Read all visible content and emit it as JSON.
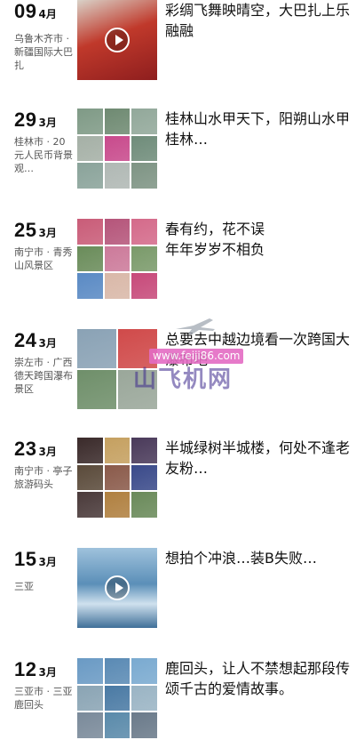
{
  "posts": [
    {
      "day": "09",
      "month": "4月",
      "location": "乌鲁木齐市 · 新疆国际大巴扎",
      "caption": "彩绸飞舞映晴空，大巴扎上乐融融",
      "media": "video",
      "colors": [
        "#c0392b"
      ]
    },
    {
      "day": "29",
      "month": "3月",
      "location": "桂林市 · 20元人民币背景观…",
      "caption": "桂林山水甲天下，阳朔山水甲桂林…",
      "media": "grid9",
      "colors": [
        "#7f9a86",
        "#6f8a72",
        "#92a89a",
        "#a5b0a6",
        "#c84a8c",
        "#6f8c7a",
        "#8aa39a",
        "#b0b8b4",
        "#7e9484"
      ]
    },
    {
      "day": "25",
      "month": "3月",
      "location": "南宁市 · 青秀山风景区",
      "caption": "春有约，花不误\n年年岁岁不相负",
      "media": "grid9",
      "colors": [
        "#c95c78",
        "#b5557a",
        "#d46a8a",
        "#6a8c5a",
        "#cc7a9a",
        "#7a9a6a",
        "#5a8ac4",
        "#d9b8a8",
        "#c74a7a"
      ]
    },
    {
      "day": "24",
      "month": "3月",
      "location": "崇左市 · 广西德天跨国瀑布景区",
      "caption": "总要去中越边境看一次跨国大瀑布吧",
      "media": "grid4",
      "colors": [
        "#8aa2b5",
        "#d04a4a",
        "#6f8f6a",
        "#9aa79a"
      ]
    },
    {
      "day": "23",
      "month": "3月",
      "location": "南宁市 · 亭子旅游码头",
      "caption": "半城绿树半城楼，何处不逢老友粉…",
      "media": "grid9",
      "colors": [
        "#3a2a2a",
        "#c5a060",
        "#4a3a5a",
        "#5a4a3a",
        "#8a5a4a",
        "#3a4a8a",
        "#4a3a3a",
        "#b08040",
        "#6a8a5a"
      ]
    },
    {
      "day": "15",
      "month": "3月",
      "location": "三亚",
      "caption": "想拍个冲浪…装B失败…",
      "media": "video",
      "colors": [
        "#5b8fb8"
      ]
    },
    {
      "day": "12",
      "month": "3月",
      "location": "三亚市 · 三亚鹿回头",
      "caption": "鹿回头，让人不禁想起那段传颂千古的爱情故事。",
      "media": "grid9",
      "colors": [
        "#6a9ac4",
        "#5a8ab4",
        "#7aaad0",
        "#8aa4b4",
        "#4a7aa4",
        "#9ab4c4",
        "#7a8a9a",
        "#5a8aaa",
        "#6a7a8a"
      ]
    }
  ],
  "watermark": {
    "url": "www.feiji86.com",
    "name": "山飞机网"
  }
}
